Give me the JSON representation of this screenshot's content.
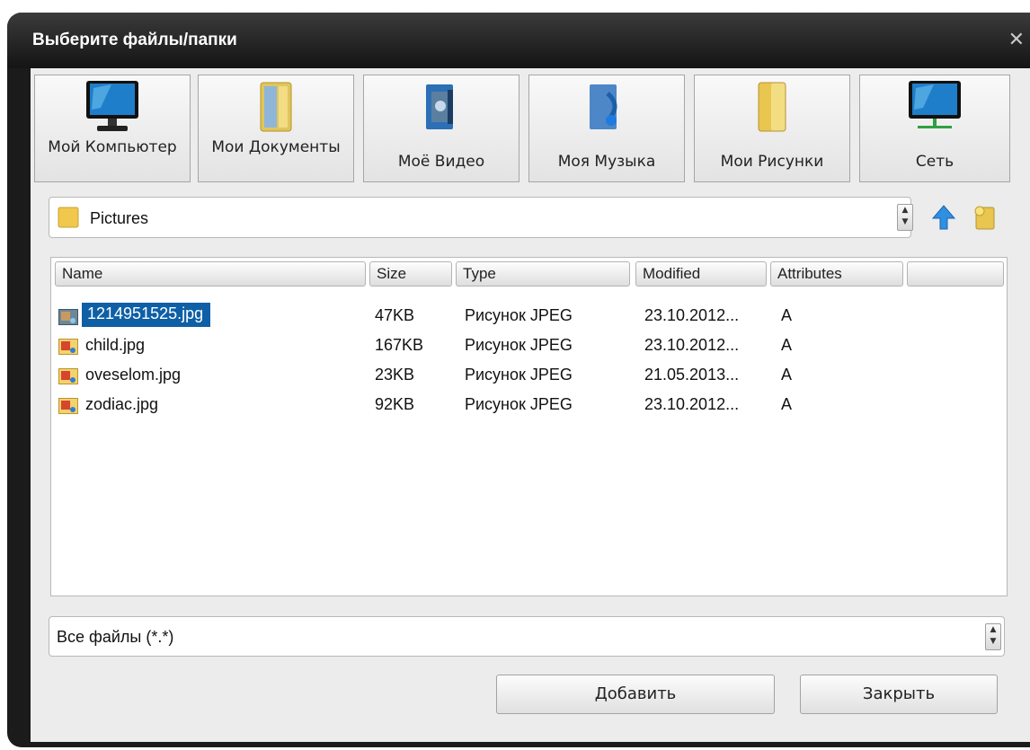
{
  "window": {
    "title": "Выберите файлы/папки"
  },
  "quick_access": [
    {
      "label": "Мой Компьютер",
      "icon": "monitor-icon"
    },
    {
      "label": "Мои Документы",
      "icon": "documents-folder-icon"
    },
    {
      "label": "Моё Видео",
      "icon": "video-icon"
    },
    {
      "label": "Моя Музыка",
      "icon": "music-icon"
    },
    {
      "label": "Мои Рисунки",
      "icon": "pictures-folder-icon"
    },
    {
      "label": "Сеть",
      "icon": "network-icon"
    }
  ],
  "path": {
    "value": "Pictures"
  },
  "columns": [
    "Name",
    "Size",
    "Type",
    "Modified",
    "Attributes",
    ""
  ],
  "files": [
    {
      "name": "1214951525.jpg",
      "size": "47KB",
      "type": "Рисунок JPEG",
      "modified": "23.10.2012...",
      "attributes": "A",
      "selected": true
    },
    {
      "name": "child.jpg",
      "size": "167KB",
      "type": "Рисунок JPEG",
      "modified": "23.10.2012...",
      "attributes": "A",
      "selected": false
    },
    {
      "name": "oveselom.jpg",
      "size": "23KB",
      "type": "Рисунок JPEG",
      "modified": "21.05.2013...",
      "attributes": "A",
      "selected": false
    },
    {
      "name": "zodiac.jpg",
      "size": "92KB",
      "type": "Рисунок JPEG",
      "modified": "23.10.2012...",
      "attributes": "A",
      "selected": false
    }
  ],
  "filter": {
    "value": "Все файлы (*.*)"
  },
  "buttons": {
    "add": "Добавить",
    "close": "Закрыть"
  },
  "colors": {
    "selection": "#0e5fa6",
    "title_bar": "#1b1b1b",
    "panel": "#ececec"
  }
}
